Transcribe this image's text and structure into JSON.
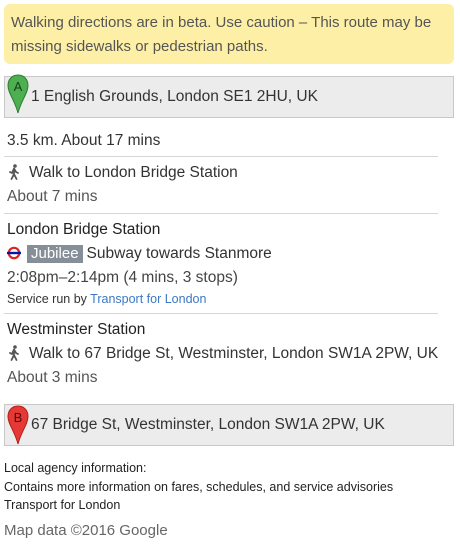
{
  "banner": {
    "text": "Walking directions are in beta. Use caution – This route may be missing sidewalks or pedestrian paths."
  },
  "origin": {
    "marker_letter": "A",
    "address": "1 English Grounds, London SE1 2HU, UK",
    "marker_color": "#4caf50"
  },
  "summary": "3.5 km. About 17 mins",
  "step1": {
    "instruction": "Walk to London Bridge Station",
    "duration": "About 7 mins"
  },
  "transit": {
    "station": "London Bridge Station",
    "line": "Jubilee",
    "line_color": "#868f98",
    "direction": "Subway towards Stanmore",
    "times": "2:08pm–2:14pm (4 mins, 3 stops)",
    "service_prefix": "Service run by",
    "service_link": "Transport for London"
  },
  "step3": {
    "station": "Westminster Station",
    "instruction": "Walk to 67 Bridge St, Westminster, London SW1A 2PW, UK",
    "duration": "About 3 mins"
  },
  "destination": {
    "marker_letter": "B",
    "address": "67 Bridge St, Westminster, London SW1A 2PW, UK",
    "marker_color": "#e53935"
  },
  "agency": {
    "heading": "Local agency information:",
    "description": "Contains more information on fares, schedules, and service advisories",
    "link": "Transport for London"
  },
  "footer": {
    "map_data": "Map data ©2016 Google"
  }
}
